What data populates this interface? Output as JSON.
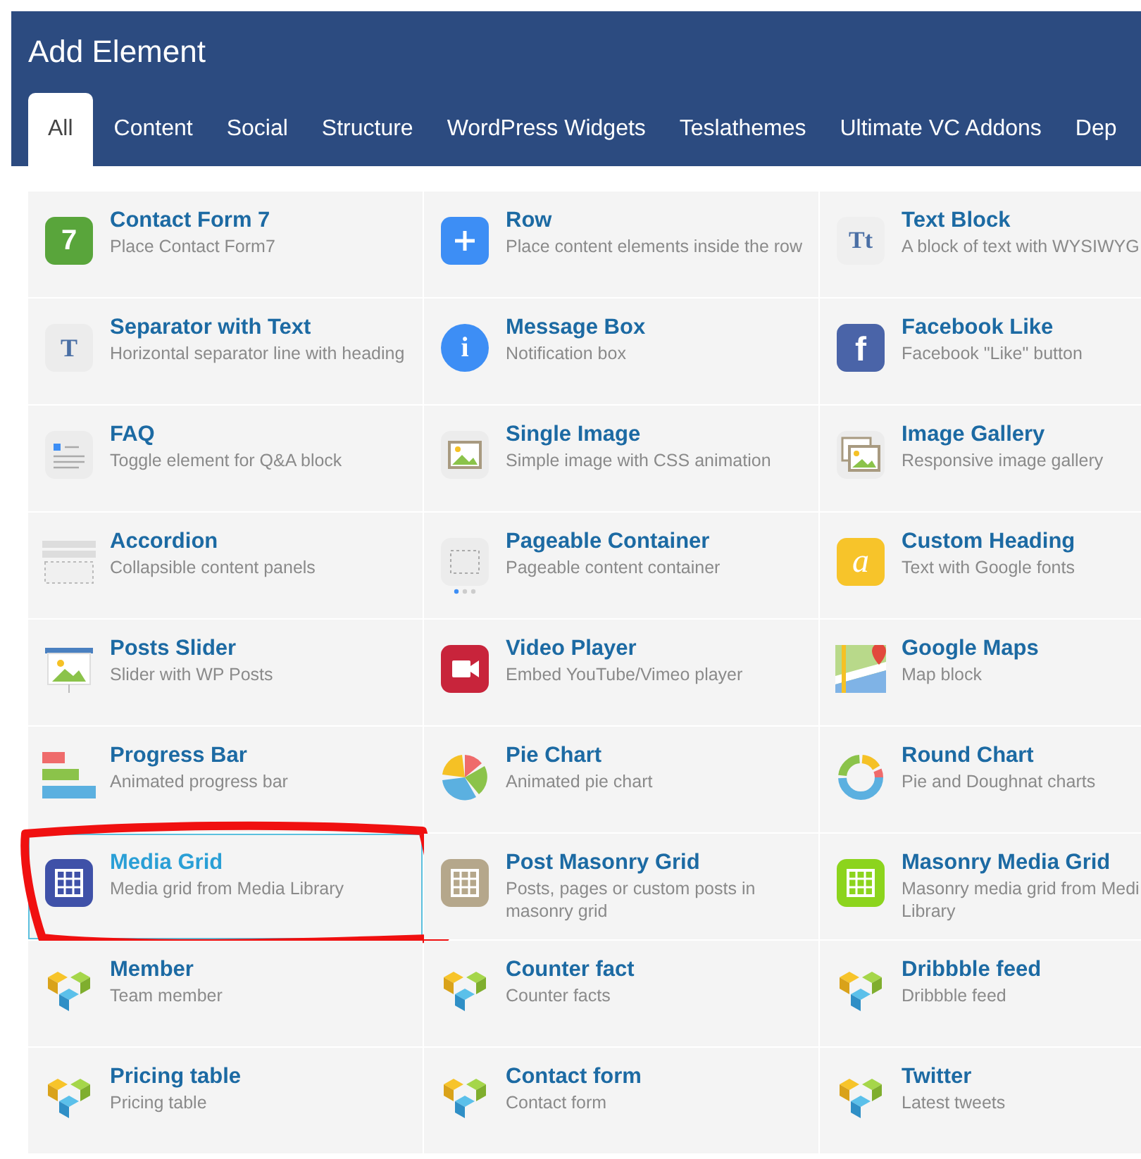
{
  "window": {
    "title": "Add Element"
  },
  "tabs": [
    {
      "label": "All",
      "selected": true
    },
    {
      "label": "Content",
      "selected": false
    },
    {
      "label": "Social",
      "selected": false
    },
    {
      "label": "Structure",
      "selected": false
    },
    {
      "label": "WordPress Widgets",
      "selected": false
    },
    {
      "label": "Teslathemes",
      "selected": false
    },
    {
      "label": "Ultimate VC Addons",
      "selected": false
    },
    {
      "label": "Dep",
      "selected": false
    }
  ],
  "elements": [
    {
      "title": "Contact Form 7",
      "description": "Place Contact Form7",
      "icon_glyph": "7",
      "selected": false,
      "circled": false
    },
    {
      "title": "Row",
      "description": "Place content elements inside the row",
      "selected": false,
      "circled": false
    },
    {
      "title": "Text Block",
      "description": "A block of text with WYSIWYG",
      "icon_glyph": "Tt",
      "selected": false,
      "circled": false
    },
    {
      "title": "Separator with Text",
      "description": "Horizontal separator line with heading",
      "icon_glyph": "T",
      "selected": false,
      "circled": false
    },
    {
      "title": "Message Box",
      "description": "Notification box",
      "icon_glyph": "i",
      "selected": false,
      "circled": false
    },
    {
      "title": "Facebook Like",
      "description": "Facebook \"Like\" button",
      "icon_glyph": "f",
      "selected": false,
      "circled": false
    },
    {
      "title": "FAQ",
      "description": "Toggle element for Q&A block",
      "selected": false,
      "circled": false
    },
    {
      "title": "Single Image",
      "description": "Simple image with CSS animation",
      "selected": false,
      "circled": false
    },
    {
      "title": "Image Gallery",
      "description": "Responsive image gallery",
      "selected": false,
      "circled": false
    },
    {
      "title": "Accordion",
      "description": "Collapsible content panels",
      "selected": false,
      "circled": false
    },
    {
      "title": "Pageable Container",
      "description": "Pageable content container",
      "selected": false,
      "circled": false
    },
    {
      "title": "Custom Heading",
      "description": "Text with Google fonts",
      "icon_glyph": "a",
      "selected": false,
      "circled": false
    },
    {
      "title": "Posts Slider",
      "description": "Slider with WP Posts",
      "selected": false,
      "circled": false
    },
    {
      "title": "Video Player",
      "description": "Embed YouTube/Vimeo player",
      "selected": false,
      "circled": false
    },
    {
      "title": "Google Maps",
      "description": "Map block",
      "selected": false,
      "circled": false
    },
    {
      "title": "Progress Bar",
      "description": "Animated progress bar",
      "selected": false,
      "circled": false
    },
    {
      "title": "Pie Chart",
      "description": "Animated pie chart",
      "selected": false,
      "circled": false
    },
    {
      "title": "Round Chart",
      "description": "Pie and Doughnat charts",
      "selected": false,
      "circled": false
    },
    {
      "title": "Media Grid",
      "description": "Media grid from Media Library",
      "selected": true,
      "circled": true
    },
    {
      "title": "Post Masonry Grid",
      "description": "Posts, pages or custom posts in masonry grid",
      "selected": false,
      "circled": false
    },
    {
      "title": "Masonry Media Grid",
      "description": "Masonry media grid from Medi Library",
      "selected": false,
      "circled": false
    },
    {
      "title": "Member",
      "description": "Team member",
      "selected": false,
      "circled": false
    },
    {
      "title": "Counter fact",
      "description": "Counter facts",
      "selected": false,
      "circled": false
    },
    {
      "title": "Dribbble feed",
      "description": "Dribbble feed",
      "selected": false,
      "circled": false
    },
    {
      "title": "Pricing table",
      "description": "Pricing table",
      "selected": false,
      "circled": false
    },
    {
      "title": "Contact form",
      "description": "Contact form",
      "selected": false,
      "circled": false
    },
    {
      "title": "Twitter",
      "description": "Latest tweets",
      "selected": false,
      "circled": false
    }
  ]
}
